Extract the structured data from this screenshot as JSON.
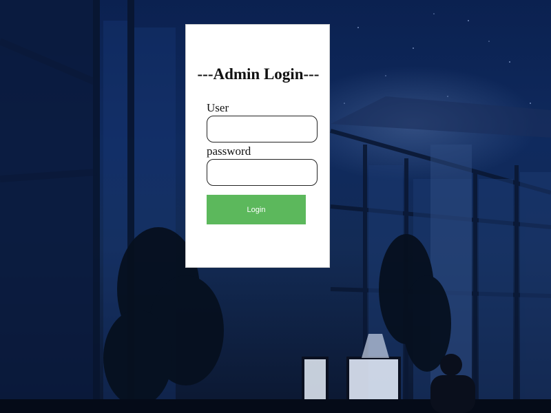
{
  "login": {
    "title": "---Admin Login---",
    "user_label": "User",
    "user_value": "",
    "password_label": "password",
    "password_value": "",
    "button_label": "Login"
  },
  "colors": {
    "button": "#5cb85c",
    "card": "#ffffff",
    "background": "#0f2a5e"
  }
}
